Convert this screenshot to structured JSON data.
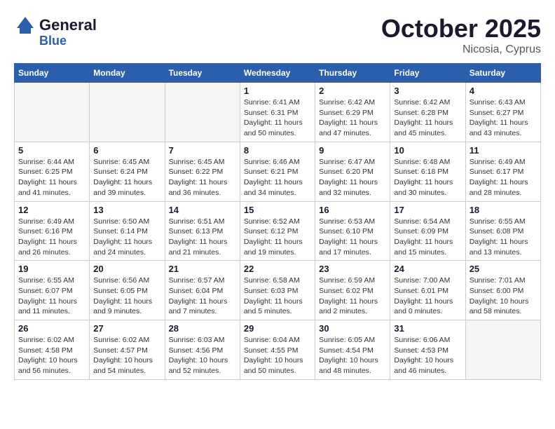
{
  "header": {
    "logo_general": "General",
    "logo_blue": "Blue",
    "month": "October 2025",
    "location": "Nicosia, Cyprus"
  },
  "days_of_week": [
    "Sunday",
    "Monday",
    "Tuesday",
    "Wednesday",
    "Thursday",
    "Friday",
    "Saturday"
  ],
  "weeks": [
    [
      {
        "day": "",
        "sunrise": "",
        "sunset": "",
        "daylight": ""
      },
      {
        "day": "",
        "sunrise": "",
        "sunset": "",
        "daylight": ""
      },
      {
        "day": "",
        "sunrise": "",
        "sunset": "",
        "daylight": ""
      },
      {
        "day": "1",
        "sunrise": "Sunrise: 6:41 AM",
        "sunset": "Sunset: 6:31 PM",
        "daylight": "Daylight: 11 hours and 50 minutes."
      },
      {
        "day": "2",
        "sunrise": "Sunrise: 6:42 AM",
        "sunset": "Sunset: 6:29 PM",
        "daylight": "Daylight: 11 hours and 47 minutes."
      },
      {
        "day": "3",
        "sunrise": "Sunrise: 6:42 AM",
        "sunset": "Sunset: 6:28 PM",
        "daylight": "Daylight: 11 hours and 45 minutes."
      },
      {
        "day": "4",
        "sunrise": "Sunrise: 6:43 AM",
        "sunset": "Sunset: 6:27 PM",
        "daylight": "Daylight: 11 hours and 43 minutes."
      }
    ],
    [
      {
        "day": "5",
        "sunrise": "Sunrise: 6:44 AM",
        "sunset": "Sunset: 6:25 PM",
        "daylight": "Daylight: 11 hours and 41 minutes."
      },
      {
        "day": "6",
        "sunrise": "Sunrise: 6:45 AM",
        "sunset": "Sunset: 6:24 PM",
        "daylight": "Daylight: 11 hours and 39 minutes."
      },
      {
        "day": "7",
        "sunrise": "Sunrise: 6:45 AM",
        "sunset": "Sunset: 6:22 PM",
        "daylight": "Daylight: 11 hours and 36 minutes."
      },
      {
        "day": "8",
        "sunrise": "Sunrise: 6:46 AM",
        "sunset": "Sunset: 6:21 PM",
        "daylight": "Daylight: 11 hours and 34 minutes."
      },
      {
        "day": "9",
        "sunrise": "Sunrise: 6:47 AM",
        "sunset": "Sunset: 6:20 PM",
        "daylight": "Daylight: 11 hours and 32 minutes."
      },
      {
        "day": "10",
        "sunrise": "Sunrise: 6:48 AM",
        "sunset": "Sunset: 6:18 PM",
        "daylight": "Daylight: 11 hours and 30 minutes."
      },
      {
        "day": "11",
        "sunrise": "Sunrise: 6:49 AM",
        "sunset": "Sunset: 6:17 PM",
        "daylight": "Daylight: 11 hours and 28 minutes."
      }
    ],
    [
      {
        "day": "12",
        "sunrise": "Sunrise: 6:49 AM",
        "sunset": "Sunset: 6:16 PM",
        "daylight": "Daylight: 11 hours and 26 minutes."
      },
      {
        "day": "13",
        "sunrise": "Sunrise: 6:50 AM",
        "sunset": "Sunset: 6:14 PM",
        "daylight": "Daylight: 11 hours and 24 minutes."
      },
      {
        "day": "14",
        "sunrise": "Sunrise: 6:51 AM",
        "sunset": "Sunset: 6:13 PM",
        "daylight": "Daylight: 11 hours and 21 minutes."
      },
      {
        "day": "15",
        "sunrise": "Sunrise: 6:52 AM",
        "sunset": "Sunset: 6:12 PM",
        "daylight": "Daylight: 11 hours and 19 minutes."
      },
      {
        "day": "16",
        "sunrise": "Sunrise: 6:53 AM",
        "sunset": "Sunset: 6:10 PM",
        "daylight": "Daylight: 11 hours and 17 minutes."
      },
      {
        "day": "17",
        "sunrise": "Sunrise: 6:54 AM",
        "sunset": "Sunset: 6:09 PM",
        "daylight": "Daylight: 11 hours and 15 minutes."
      },
      {
        "day": "18",
        "sunrise": "Sunrise: 6:55 AM",
        "sunset": "Sunset: 6:08 PM",
        "daylight": "Daylight: 11 hours and 13 minutes."
      }
    ],
    [
      {
        "day": "19",
        "sunrise": "Sunrise: 6:55 AM",
        "sunset": "Sunset: 6:07 PM",
        "daylight": "Daylight: 11 hours and 11 minutes."
      },
      {
        "day": "20",
        "sunrise": "Sunrise: 6:56 AM",
        "sunset": "Sunset: 6:05 PM",
        "daylight": "Daylight: 11 hours and 9 minutes."
      },
      {
        "day": "21",
        "sunrise": "Sunrise: 6:57 AM",
        "sunset": "Sunset: 6:04 PM",
        "daylight": "Daylight: 11 hours and 7 minutes."
      },
      {
        "day": "22",
        "sunrise": "Sunrise: 6:58 AM",
        "sunset": "Sunset: 6:03 PM",
        "daylight": "Daylight: 11 hours and 5 minutes."
      },
      {
        "day": "23",
        "sunrise": "Sunrise: 6:59 AM",
        "sunset": "Sunset: 6:02 PM",
        "daylight": "Daylight: 11 hours and 2 minutes."
      },
      {
        "day": "24",
        "sunrise": "Sunrise: 7:00 AM",
        "sunset": "Sunset: 6:01 PM",
        "daylight": "Daylight: 11 hours and 0 minutes."
      },
      {
        "day": "25",
        "sunrise": "Sunrise: 7:01 AM",
        "sunset": "Sunset: 6:00 PM",
        "daylight": "Daylight: 10 hours and 58 minutes."
      }
    ],
    [
      {
        "day": "26",
        "sunrise": "Sunrise: 6:02 AM",
        "sunset": "Sunset: 4:58 PM",
        "daylight": "Daylight: 10 hours and 56 minutes."
      },
      {
        "day": "27",
        "sunrise": "Sunrise: 6:02 AM",
        "sunset": "Sunset: 4:57 PM",
        "daylight": "Daylight: 10 hours and 54 minutes."
      },
      {
        "day": "28",
        "sunrise": "Sunrise: 6:03 AM",
        "sunset": "Sunset: 4:56 PM",
        "daylight": "Daylight: 10 hours and 52 minutes."
      },
      {
        "day": "29",
        "sunrise": "Sunrise: 6:04 AM",
        "sunset": "Sunset: 4:55 PM",
        "daylight": "Daylight: 10 hours and 50 minutes."
      },
      {
        "day": "30",
        "sunrise": "Sunrise: 6:05 AM",
        "sunset": "Sunset: 4:54 PM",
        "daylight": "Daylight: 10 hours and 48 minutes."
      },
      {
        "day": "31",
        "sunrise": "Sunrise: 6:06 AM",
        "sunset": "Sunset: 4:53 PM",
        "daylight": "Daylight: 10 hours and 46 minutes."
      },
      {
        "day": "",
        "sunrise": "",
        "sunset": "",
        "daylight": ""
      }
    ]
  ]
}
